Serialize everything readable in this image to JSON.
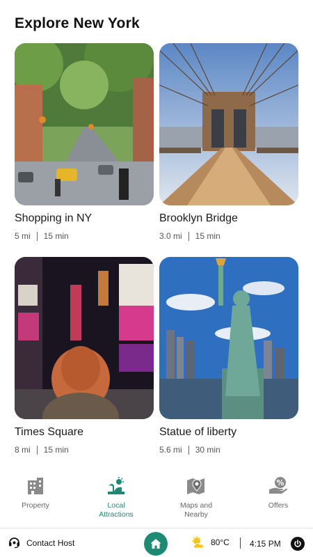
{
  "header": {
    "title": "Explore New York"
  },
  "attractions": [
    {
      "name": "Shopping in NY",
      "distance": "5 mi",
      "duration": "15 min",
      "image": "street-photo"
    },
    {
      "name": "Brooklyn Bridge",
      "distance": "3.0 mi",
      "duration": "15 min",
      "image": "bridge-photo"
    },
    {
      "name": "Times Square",
      "distance": "8 mi",
      "duration": "15 min",
      "image": "times-square-photo"
    },
    {
      "name": "Statue of liberty",
      "distance": "5.6 mi",
      "duration": "30 min",
      "image": "statue-photo"
    }
  ],
  "tabs": [
    {
      "label": "Property",
      "icon": "building-icon",
      "active": false
    },
    {
      "label": "Local\nAttractions",
      "icon": "attractions-icon",
      "active": true
    },
    {
      "label": "Maps and\nNearby",
      "icon": "map-pin-icon",
      "active": false
    },
    {
      "label": "Offers",
      "icon": "percent-offer-icon",
      "active": false
    }
  ],
  "bottom_bar": {
    "contact_label": "Contact Host",
    "temperature": "80°C",
    "time": "4:15 PM",
    "weather_icon": "partly-sunny-icon"
  },
  "colors": {
    "accent": "#1f8a74",
    "text": "#1a1a1a",
    "muted": "#555555"
  }
}
